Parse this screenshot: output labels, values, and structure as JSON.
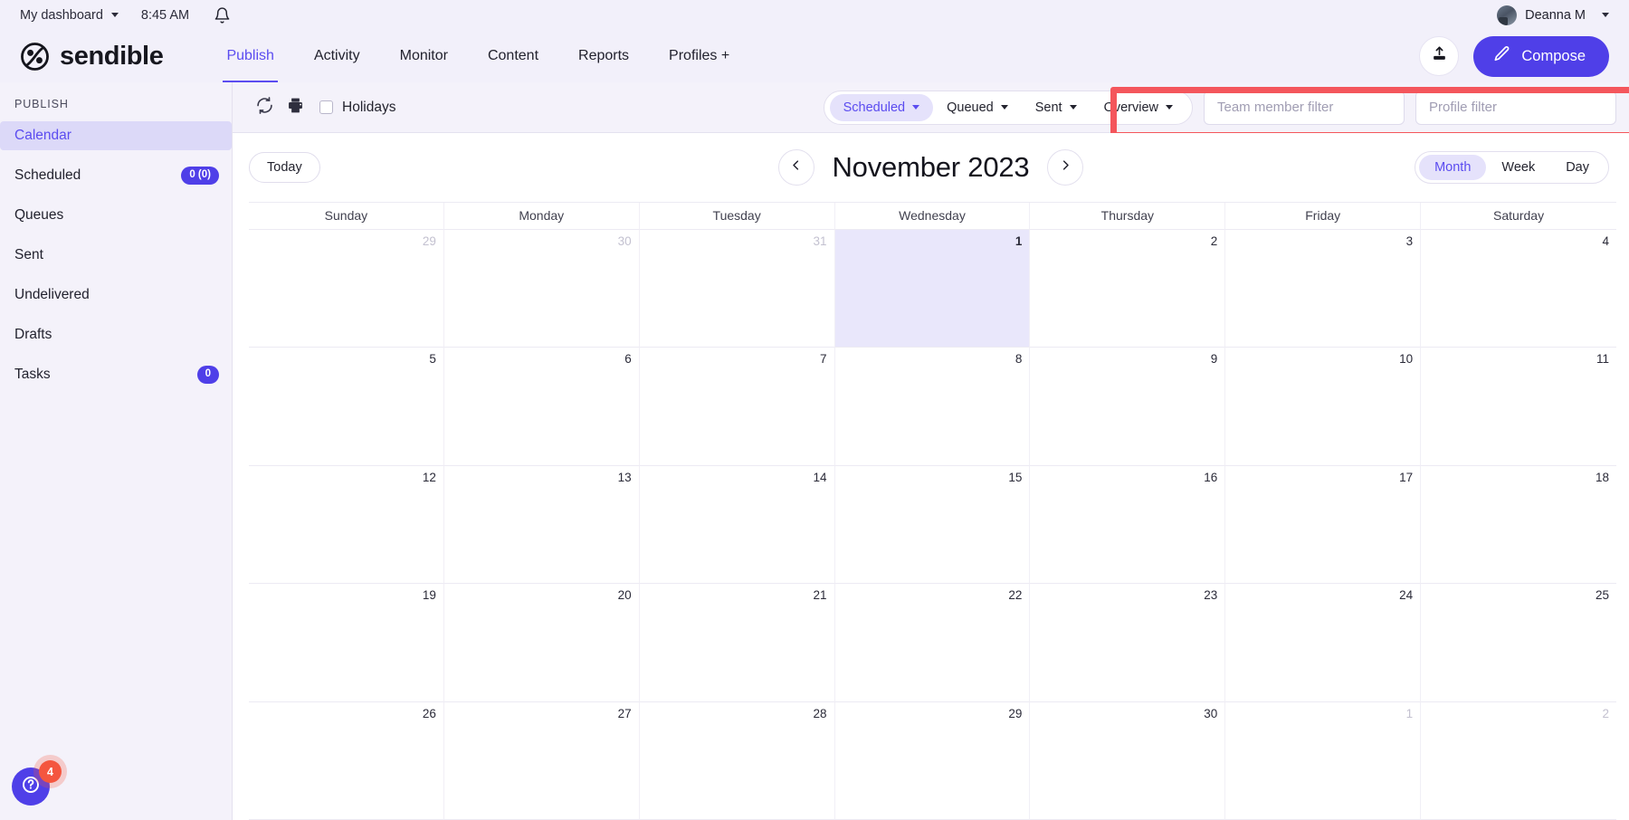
{
  "utilbar": {
    "dashboard_label": "My dashboard",
    "time": "8:45 AM",
    "bell_icon": "bell-icon",
    "user_name": "Deanna M"
  },
  "brand": {
    "name": "sendible",
    "logo_icon": "sendible-logo-icon"
  },
  "nav": {
    "items": [
      {
        "label": "Publish",
        "active": true
      },
      {
        "label": "Activity",
        "active": false
      },
      {
        "label": "Monitor",
        "active": false
      },
      {
        "label": "Content",
        "active": false
      },
      {
        "label": "Reports",
        "active": false
      },
      {
        "label": "Profiles +",
        "active": false
      }
    ],
    "upload_icon": "upload-icon",
    "compose_label": "Compose",
    "compose_icon": "pencil-icon",
    "accent_color": "#4f3fe8"
  },
  "sidebar": {
    "section_label": "PUBLISH",
    "items": [
      {
        "label": "Calendar",
        "badge": null,
        "active": true
      },
      {
        "label": "Scheduled",
        "badge": "0 (0)",
        "active": false
      },
      {
        "label": "Queues",
        "badge": null,
        "active": false
      },
      {
        "label": "Sent",
        "badge": null,
        "active": false
      },
      {
        "label": "Undelivered",
        "badge": null,
        "active": false
      },
      {
        "label": "Drafts",
        "badge": null,
        "active": false
      },
      {
        "label": "Tasks",
        "badge": "0",
        "active": false
      }
    ],
    "help_icon": "question-mark-icon",
    "help_badge": "4"
  },
  "toolbar": {
    "refresh_icon": "refresh-icon",
    "print_icon": "printer-icon",
    "holidays_label": "Holidays",
    "holidays_checked": false,
    "filter_buttons": [
      {
        "label": "Scheduled",
        "selected": true
      },
      {
        "label": "Queued",
        "selected": false
      },
      {
        "label": "Sent",
        "selected": false
      },
      {
        "label": "Overview",
        "selected": false
      }
    ],
    "team_member_filter_placeholder": "Team member filter",
    "team_member_filter_value": "",
    "profile_filter_placeholder": "Profile filter",
    "profile_filter_value": "",
    "highlight_color": "#f4565c"
  },
  "calendar": {
    "today_label": "Today",
    "prev_icon": "chevron-left-icon",
    "next_icon": "chevron-right-icon",
    "title": "November 2023",
    "views": [
      {
        "label": "Month",
        "selected": true
      },
      {
        "label": "Week",
        "selected": false
      },
      {
        "label": "Day",
        "selected": false
      }
    ],
    "day_headers": [
      "Sunday",
      "Monday",
      "Tuesday",
      "Wednesday",
      "Thursday",
      "Friday",
      "Saturday"
    ],
    "weeks": [
      [
        {
          "num": "29",
          "out": true,
          "hl": false
        },
        {
          "num": "30",
          "out": true,
          "hl": false
        },
        {
          "num": "31",
          "out": true,
          "hl": false
        },
        {
          "num": "1",
          "out": false,
          "hl": true
        },
        {
          "num": "2",
          "out": false,
          "hl": false
        },
        {
          "num": "3",
          "out": false,
          "hl": false
        },
        {
          "num": "4",
          "out": false,
          "hl": false
        }
      ],
      [
        {
          "num": "5",
          "out": false,
          "hl": false
        },
        {
          "num": "6",
          "out": false,
          "hl": false
        },
        {
          "num": "7",
          "out": false,
          "hl": false
        },
        {
          "num": "8",
          "out": false,
          "hl": false
        },
        {
          "num": "9",
          "out": false,
          "hl": false
        },
        {
          "num": "10",
          "out": false,
          "hl": false
        },
        {
          "num": "11",
          "out": false,
          "hl": false
        }
      ],
      [
        {
          "num": "12",
          "out": false,
          "hl": false
        },
        {
          "num": "13",
          "out": false,
          "hl": false
        },
        {
          "num": "14",
          "out": false,
          "hl": false
        },
        {
          "num": "15",
          "out": false,
          "hl": false
        },
        {
          "num": "16",
          "out": false,
          "hl": false
        },
        {
          "num": "17",
          "out": false,
          "hl": false
        },
        {
          "num": "18",
          "out": false,
          "hl": false
        }
      ],
      [
        {
          "num": "19",
          "out": false,
          "hl": false
        },
        {
          "num": "20",
          "out": false,
          "hl": false
        },
        {
          "num": "21",
          "out": false,
          "hl": false
        },
        {
          "num": "22",
          "out": false,
          "hl": false
        },
        {
          "num": "23",
          "out": false,
          "hl": false
        },
        {
          "num": "24",
          "out": false,
          "hl": false
        },
        {
          "num": "25",
          "out": false,
          "hl": false
        }
      ],
      [
        {
          "num": "26",
          "out": false,
          "hl": false
        },
        {
          "num": "27",
          "out": false,
          "hl": false
        },
        {
          "num": "28",
          "out": false,
          "hl": false
        },
        {
          "num": "29",
          "out": false,
          "hl": false
        },
        {
          "num": "30",
          "out": false,
          "hl": false
        },
        {
          "num": "1",
          "out": true,
          "hl": false
        },
        {
          "num": "2",
          "out": true,
          "hl": false
        }
      ]
    ]
  }
}
